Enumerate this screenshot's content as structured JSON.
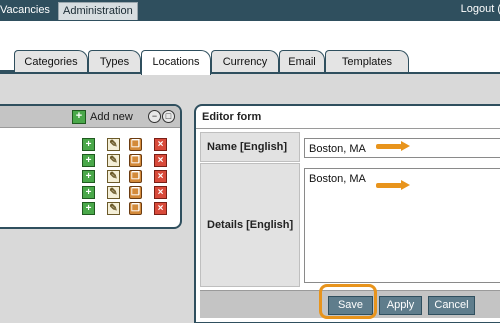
{
  "topnav": {
    "tabs": [
      "Vacancies",
      "Administration"
    ],
    "active_tab": "Administration",
    "logout_label": "Logout (…"
  },
  "subtabs": {
    "items": [
      "Categories",
      "Types",
      "Locations",
      "Currency",
      "Email",
      "Templates"
    ],
    "active": "Locations"
  },
  "list_panel": {
    "add_new_label": "Add new",
    "rows": 5,
    "row_actions": [
      "add-icon",
      "edit-icon",
      "copy-icon",
      "delete-icon"
    ]
  },
  "editor": {
    "title": "Editor form",
    "name_label": "Name [English]",
    "name_value": "Boston, MA",
    "details_label": "Details [English]",
    "details_value": "Boston, MA",
    "buttons": {
      "save": "Save",
      "apply": "Apply",
      "cancel": "Cancel"
    }
  },
  "annotations": {
    "accent_color": "#e8941c"
  }
}
